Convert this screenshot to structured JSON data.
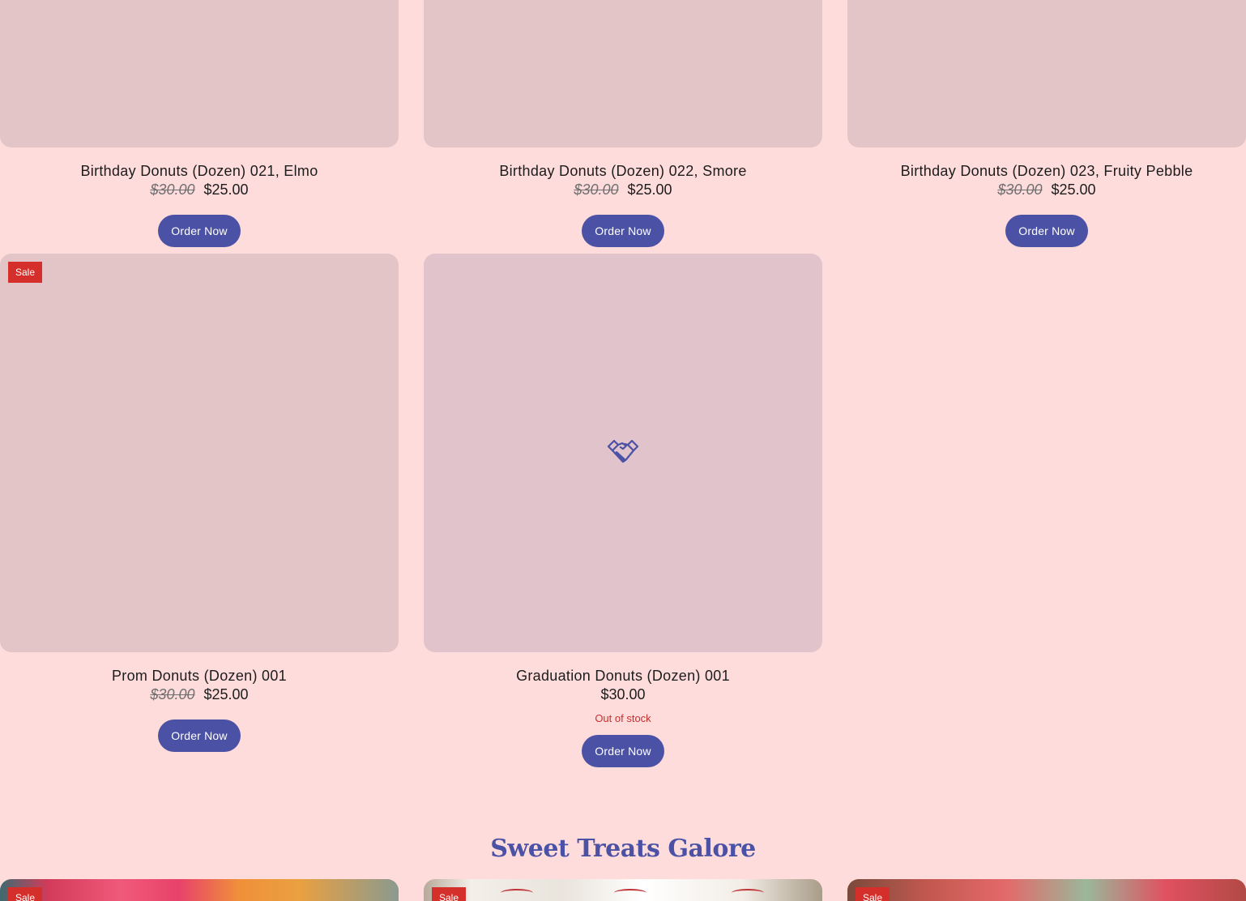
{
  "products": [
    {
      "title": "Birthday Donuts (Dozen) 021, Elmo",
      "old_price": "$30.00",
      "price": "$25.00",
      "button": "Order Now"
    },
    {
      "title": "Birthday Donuts (Dozen) 022, Smore",
      "old_price": "$30.00",
      "price": "$25.00",
      "button": "Order Now"
    },
    {
      "title": "Birthday Donuts (Dozen) 023, Fruity Pebble",
      "old_price": "$30.00",
      "price": "$25.00",
      "button": "Order Now"
    },
    {
      "badge": "Sale",
      "title": "Prom Donuts (Dozen) 001",
      "old_price": "$30.00",
      "price": "$25.00",
      "button": "Order Now"
    },
    {
      "title": "Graduation Donuts (Dozen) 001",
      "price": "$30.00",
      "stock": "Out of stock",
      "button": "Order Now",
      "icon": "handshake-icon"
    }
  ],
  "section": {
    "title": "Sweet Treats Galore",
    "previews": [
      {
        "badge": "Sale"
      },
      {
        "badge": "Sale"
      },
      {
        "badge": "Sale"
      }
    ]
  },
  "colors": {
    "page_background": "#ffdcdc",
    "accent": "#4b51a4",
    "sale_badge": "#d42f2a",
    "out_of_stock": "#c3302d"
  }
}
